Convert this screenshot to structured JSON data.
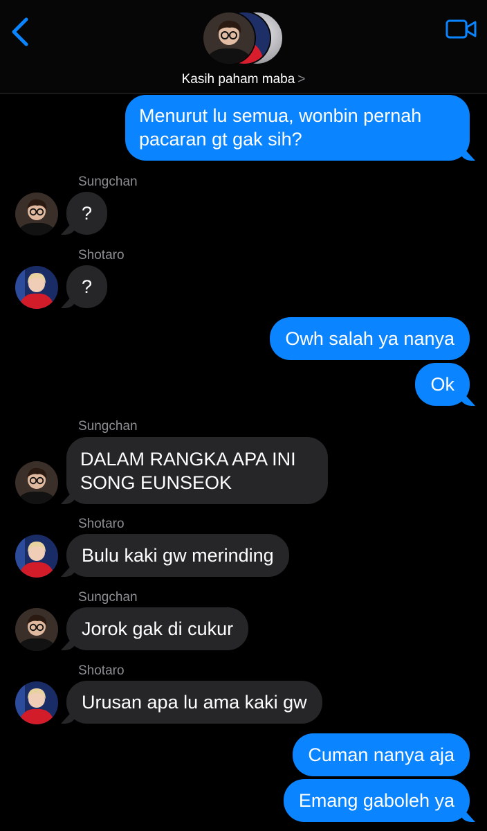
{
  "header": {
    "group_name": "Kasih paham maba",
    "chevron": ">",
    "back_icon": "chevron-left-icon",
    "video_icon": "video-camera-icon",
    "accent": "#0a84ff"
  },
  "colors": {
    "outgoing_bubble": "#0a84ff",
    "incoming_bubble": "#262629",
    "background": "#000000",
    "sender_name": "#8e8e93"
  },
  "messages": [
    {
      "dir": "out",
      "text": "Menurut lu semua, wonbin pernah\npacaran gt gak sih?"
    },
    {
      "dir": "in",
      "sender": "Sungchan",
      "text": "?"
    },
    {
      "dir": "in",
      "sender": "Shotaro",
      "text": "?"
    },
    {
      "dir": "out",
      "text": "Owh salah ya nanya"
    },
    {
      "dir": "out",
      "text": "Ok"
    },
    {
      "dir": "in",
      "sender": "Sungchan",
      "text": "DALAM RANGKA APA INI\nSONG EUNSEOK"
    },
    {
      "dir": "in",
      "sender": "Shotaro",
      "text": "Bulu kaki gw merinding"
    },
    {
      "dir": "in",
      "sender": "Sungchan",
      "text": "Jorok gak di cukur"
    },
    {
      "dir": "in",
      "sender": "Shotaro",
      "text": "Urusan apa lu ama kaki gw"
    },
    {
      "dir": "out",
      "text": "Cuman nanya aja"
    },
    {
      "dir": "out",
      "text": "Emang gaboleh ya"
    }
  ]
}
